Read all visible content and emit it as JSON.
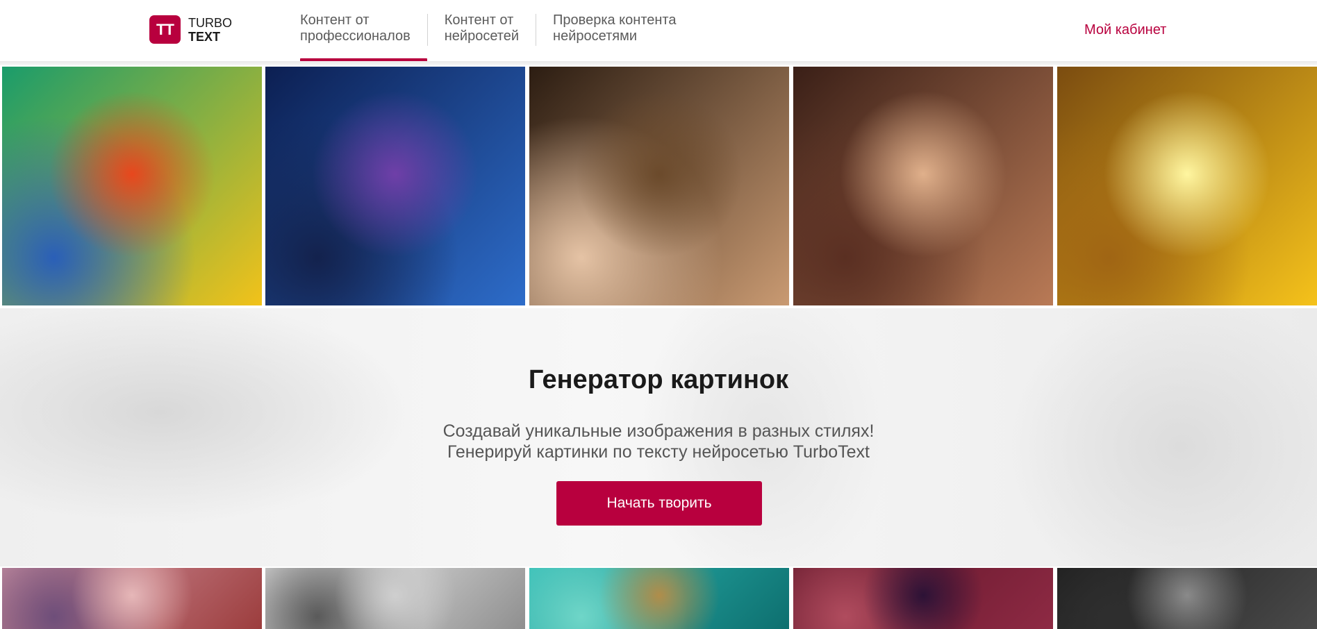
{
  "header": {
    "logo": {
      "mark": "TT",
      "line1": "TURBO",
      "line2": "TEXT"
    },
    "nav": [
      {
        "line1": "Контент от",
        "line2": "профессионалов",
        "active": true
      },
      {
        "line1": "Контент от",
        "line2": "нейросетей",
        "active": false
      },
      {
        "line1": "Проверка контента",
        "line2": "нейросетями",
        "active": false
      }
    ],
    "cabinet_label": "Мой кабинет"
  },
  "gallery_top": [
    {
      "name": "cubist-cat-image",
      "palette": [
        "#1a9c6b",
        "#f2c21a",
        "#e8471d",
        "#2a5fb8",
        "#6ac14a"
      ]
    },
    {
      "name": "blue-fairy-face-image",
      "palette": [
        "#0c1f52",
        "#2d6cc9",
        "#6f3fa8",
        "#13224d"
      ]
    },
    {
      "name": "braided-girl-portrait-image",
      "palette": [
        "#2c1d12",
        "#c99a72",
        "#6b4a2b",
        "#e5c3a5"
      ]
    },
    {
      "name": "fluffy-cat-image",
      "palette": [
        "#3a1f17",
        "#b97a56",
        "#e0b08b",
        "#5a2f22"
      ]
    },
    {
      "name": "sunny-city-painting-image",
      "palette": [
        "#7b4c10",
        "#f5c21b",
        "#fff6a0",
        "#a06514"
      ]
    }
  ],
  "hero": {
    "title": "Генератор картинок",
    "subtitle_line1": "Создавай уникальные изображения в разных стилях!",
    "subtitle_line2": "Генерируй картинки по тексту нейросетью TurboText",
    "button_label": "Начать творить"
  },
  "gallery_bottom": [
    {
      "name": "balloons-image",
      "palette": [
        "#d59aa8",
        "#9c3d3d",
        "#e6b7b8",
        "#6e4e7a"
      ]
    },
    {
      "name": "pencil-mountains-image",
      "palette": [
        "#f3f3f3",
        "#8f8f8f",
        "#cfcfcf",
        "#5a5a5a"
      ]
    },
    {
      "name": "submarine-image",
      "palette": [
        "#2bbab4",
        "#0e6f6f",
        "#b08d4a",
        "#6fd6c8"
      ]
    },
    {
      "name": "red-portrait-image",
      "palette": [
        "#5c1326",
        "#8e2a44",
        "#2c1236",
        "#b04c5e"
      ]
    },
    {
      "name": "dark-sketch-image",
      "palette": [
        "#1c1c1c",
        "#4a4a4a",
        "#8a8a8a",
        "#2e2e2e"
      ]
    }
  ],
  "colors": {
    "accent": "#b8003e",
    "text": "#1a1a1a",
    "muted": "#555555"
  }
}
